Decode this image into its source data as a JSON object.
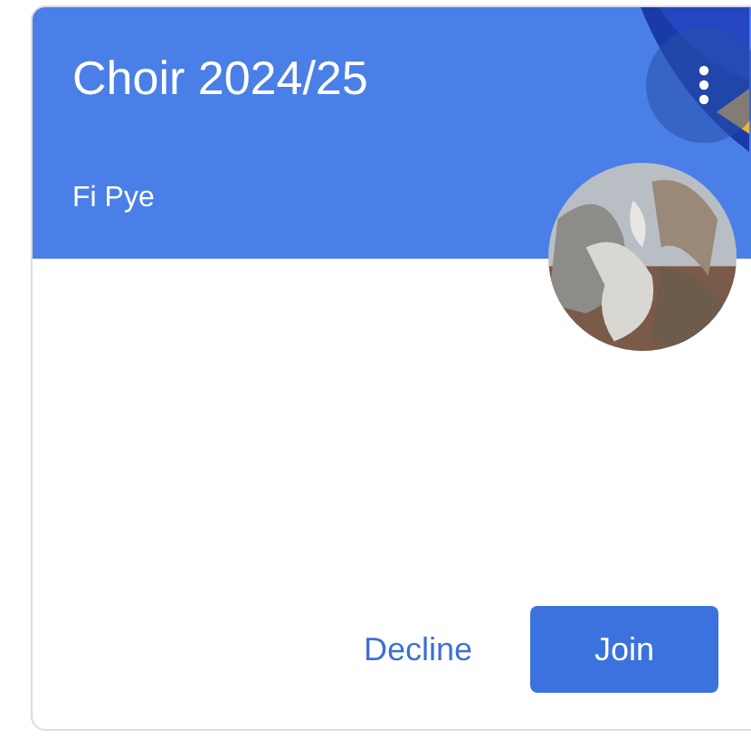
{
  "card": {
    "title": "Choir 2024/25",
    "owner": "Fi Pye",
    "buttons": [
      {
        "label": "Decline",
        "kind": "text"
      },
      {
        "label": "Join",
        "kind": "filled"
      }
    ]
  }
}
